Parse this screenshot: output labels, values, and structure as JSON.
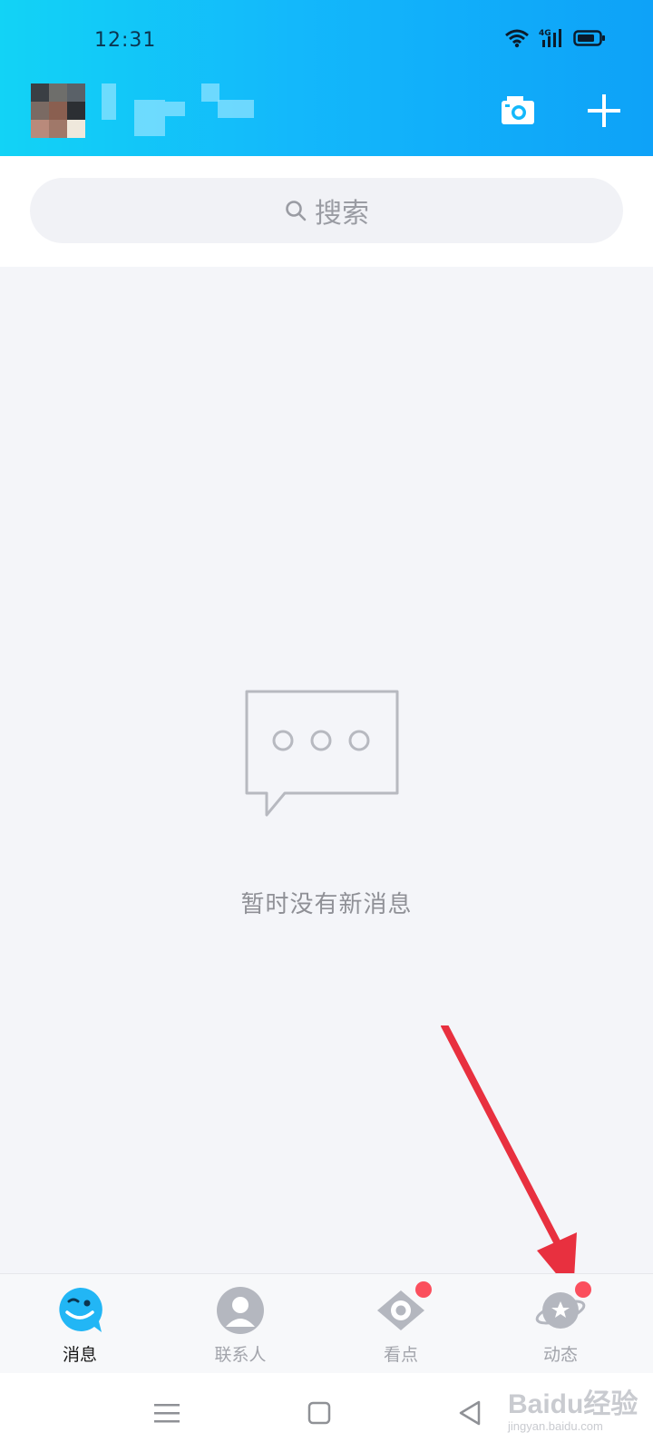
{
  "status_bar": {
    "time": "12:31",
    "network_label": "4G"
  },
  "header": {
    "camera_icon": "camera-icon",
    "add_icon": "plus-icon"
  },
  "search": {
    "placeholder": "搜索",
    "icon": "search-icon"
  },
  "empty_state": {
    "icon": "chat-bubble-icon",
    "message": "暂时没有新消息"
  },
  "tabs": [
    {
      "label": "消息",
      "icon": "chat-face-icon",
      "active": true,
      "badge": false
    },
    {
      "label": "联系人",
      "icon": "contact-icon",
      "active": false,
      "badge": false
    },
    {
      "label": "看点",
      "icon": "eye-icon",
      "active": false,
      "badge": true
    },
    {
      "label": "动态",
      "icon": "planet-icon",
      "active": false,
      "badge": true
    }
  ],
  "colors": {
    "header_gradient_start": "#12d3f6",
    "header_gradient_end": "#0ea2f8",
    "badge": "#fb4f5d",
    "annotation_arrow": "#e8303f"
  },
  "watermark": {
    "main": "Baidu经验",
    "sub": "jingyan.baidu.com"
  }
}
